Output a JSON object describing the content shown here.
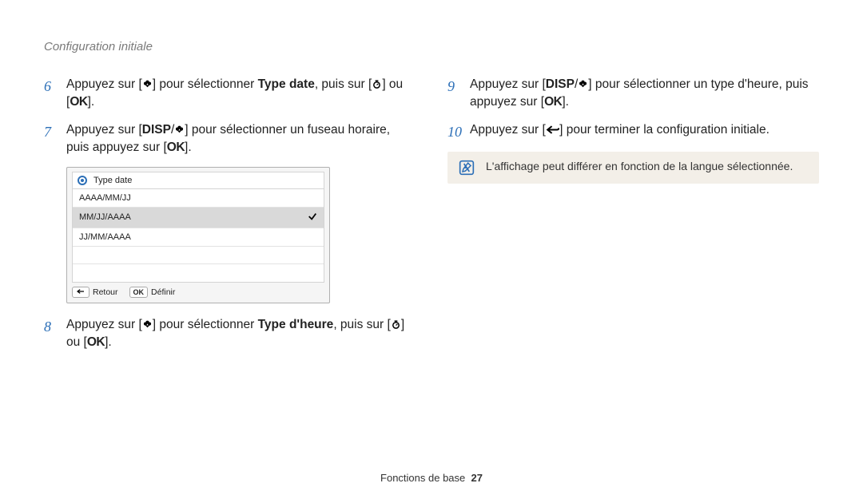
{
  "header": "Configuration initiale",
  "labels": {
    "disp": "DISP",
    "ok": "OK"
  },
  "left": {
    "steps": [
      {
        "num": "6",
        "pre": "Appuyez sur [",
        "mid1": "] pour sélectionner ",
        "bold": "Type date",
        "mid2": ", puis sur [",
        "mid3": "] ou [",
        "end": "]."
      },
      {
        "num": "7",
        "pre": "Appuyez sur [",
        "mid1": "/",
        "mid2": "] pour sélectionner un fuseau horaire, puis appuyez sur [",
        "end": "]."
      },
      {
        "num": "8",
        "pre": "Appuyez sur [",
        "mid1": "] pour sélectionner ",
        "bold": "Type d'heure",
        "mid2": ", puis sur [",
        "mid3": "] ou [",
        "end": "]."
      }
    ],
    "screenshot": {
      "title": "Type date",
      "rows": [
        "AAAA/MM/JJ",
        "MM/JJ/AAAA",
        "JJ/MM/AAAA",
        "",
        ""
      ],
      "selectedIndex": 1,
      "footer": {
        "back": "Retour",
        "set": "Définir",
        "okLabel": "OK"
      }
    }
  },
  "right": {
    "steps": [
      {
        "num": "9",
        "pre": "Appuyez sur [",
        "mid1": "/",
        "mid2": "] pour sélectionner un type d'heure, puis appuyez sur [",
        "end": "]."
      },
      {
        "num": "10",
        "pre": "Appuyez sur [",
        "mid1": "] pour terminer la configuration initiale."
      }
    ],
    "note": "L'affichage peut différer en fonction de la langue sélectionnée."
  },
  "footer": {
    "section": "Fonctions de base",
    "page": "27"
  }
}
